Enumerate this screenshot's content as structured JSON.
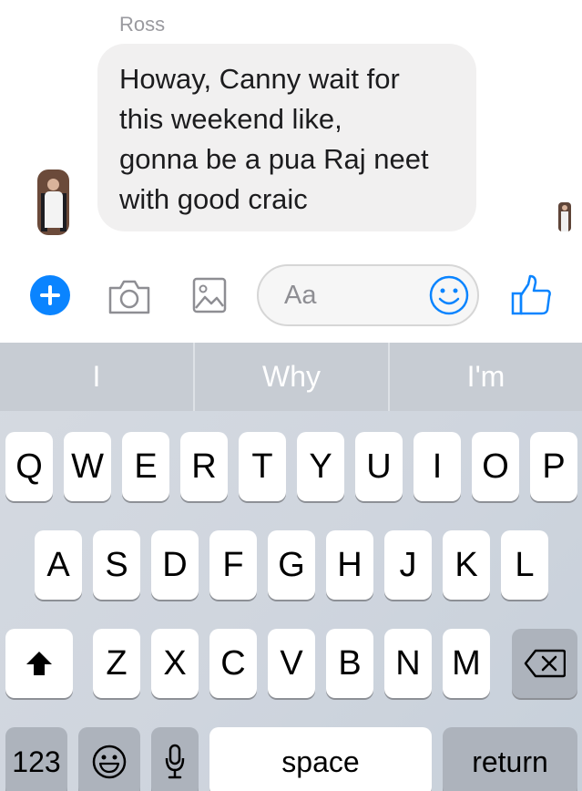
{
  "chat": {
    "sender_name": "Ross",
    "message_text": "Howay, Canny wait for\nthis weekend like,\ngonna be a pua Raj neet\nwith good craic"
  },
  "composer": {
    "placeholder": "Aa",
    "icons": [
      "plus-icon",
      "camera-icon",
      "photo-icon",
      "emoji-icon",
      "thumbs-up-icon"
    ],
    "accent_color": "#0a84ff"
  },
  "keyboard": {
    "suggestions": [
      "I",
      "Why",
      "I'm"
    ],
    "row1": [
      "Q",
      "W",
      "E",
      "R",
      "T",
      "Y",
      "U",
      "I",
      "O",
      "P"
    ],
    "row2": [
      "A",
      "S",
      "D",
      "F",
      "G",
      "H",
      "J",
      "K",
      "L"
    ],
    "row3": [
      "Z",
      "X",
      "C",
      "V",
      "B",
      "N",
      "M"
    ],
    "bottom": {
      "numbers_label": "123",
      "space_label": "space",
      "return_label": "return"
    },
    "icons": [
      "shift-icon",
      "backspace-icon",
      "emoji-keyboard-icon",
      "microphone-icon"
    ]
  }
}
